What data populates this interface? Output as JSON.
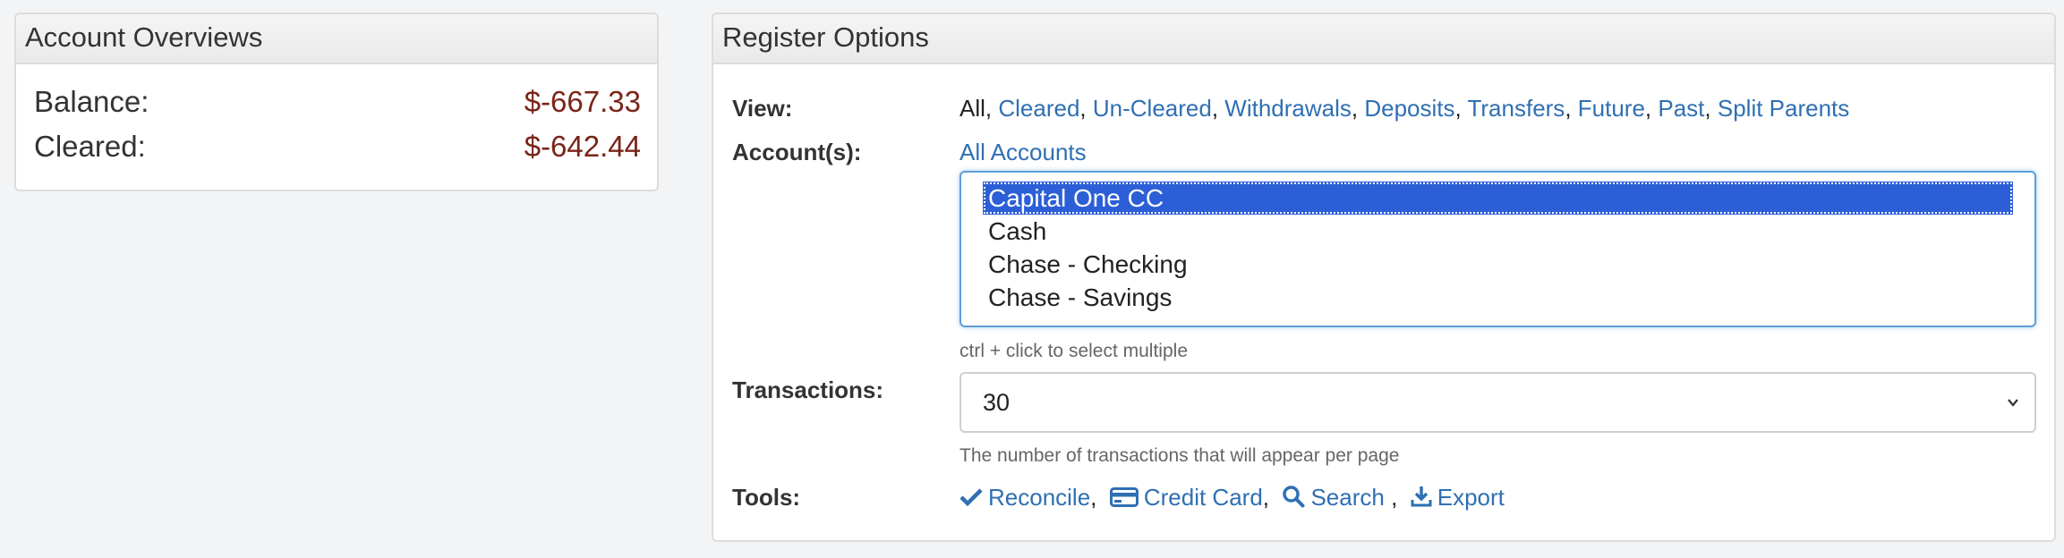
{
  "overview": {
    "title": "Account Overviews",
    "balance_label": "Balance:",
    "balance_value": "$-667.33",
    "cleared_label": "Cleared:",
    "cleared_value": "$-642.44"
  },
  "register": {
    "title": "Register Options",
    "view_label": "View:",
    "view_current": "All",
    "view_links": [
      "Cleared",
      "Un-Cleared",
      "Withdrawals",
      "Deposits",
      "Transfers",
      "Future",
      "Past",
      "Split Parents"
    ],
    "accounts_label": "Account(s):",
    "all_accounts": "All Accounts",
    "accounts_options": [
      "Capital One CC",
      "Cash",
      "Chase - Checking",
      "Chase - Savings"
    ],
    "accounts_selected": "Capital One CC",
    "ctrl_help": "ctrl + click to select multiple",
    "transactions_label": "Transactions:",
    "transactions_value": "30",
    "transactions_help": "The number of transactions that will appear per page",
    "tools_label": "Tools:",
    "tools": [
      {
        "label": "Reconcile",
        "icon": "check-icon"
      },
      {
        "label": "Credit Card",
        "icon": "credit-card-icon"
      },
      {
        "label": "Search",
        "icon": "search-icon"
      },
      {
        "label": "Export",
        "icon": "download-icon"
      }
    ]
  },
  "colors": {
    "link": "#2f6fb3",
    "negative_amount": "#7a2418",
    "selected_option": "#2c5fd7",
    "focus_border": "#5e9ed6"
  }
}
